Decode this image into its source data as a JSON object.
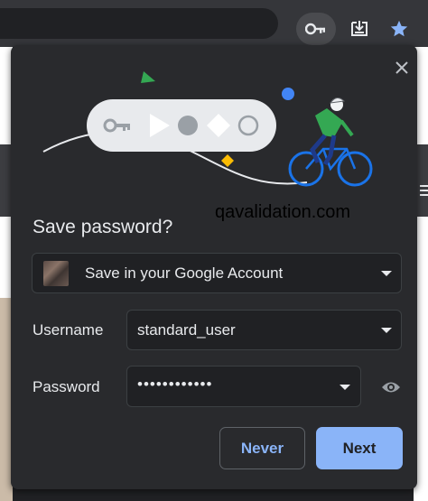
{
  "toolbar": {
    "icons": [
      "key-icon",
      "download-icon",
      "star-icon"
    ],
    "accent": "#8ab4f8"
  },
  "dialog": {
    "site": "qavalidation.com",
    "title": "Save password?",
    "account_selector": "Save in your Google Account",
    "username_label": "Username",
    "username_value": "standard_user",
    "password_label": "Password",
    "password_value": "••••••••••••",
    "never_label": "Never",
    "next_label": "Next"
  }
}
